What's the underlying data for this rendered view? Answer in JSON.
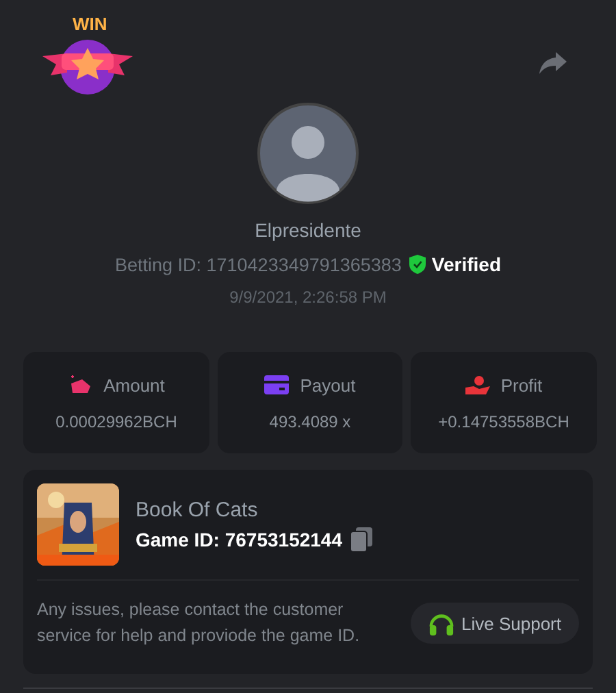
{
  "badge": {
    "text": "WIN"
  },
  "user": {
    "name": "Elpresidente",
    "betting_id": "Betting ID: 1710423349791365383",
    "verified": true,
    "verified_label": "Verified",
    "date": "9/9/2021, 2:26:58 PM"
  },
  "stats": [
    {
      "kind": "amount",
      "label": "Amount",
      "value": "0.00029962BCH",
      "color": "#e8336b"
    },
    {
      "kind": "payout",
      "label": "Payout",
      "value": "493.4089 x",
      "color": "#7b3ff2"
    },
    {
      "kind": "profit",
      "label": "Profit",
      "value": "+0.14753558BCH",
      "color": "#e8343a"
    }
  ],
  "game": {
    "title": "Book Of Cats",
    "game_id": "Game ID: 76753152144",
    "note": "Any issues, please contact the customer service for help and proviode the game ID.",
    "support_button": "Live Support"
  }
}
